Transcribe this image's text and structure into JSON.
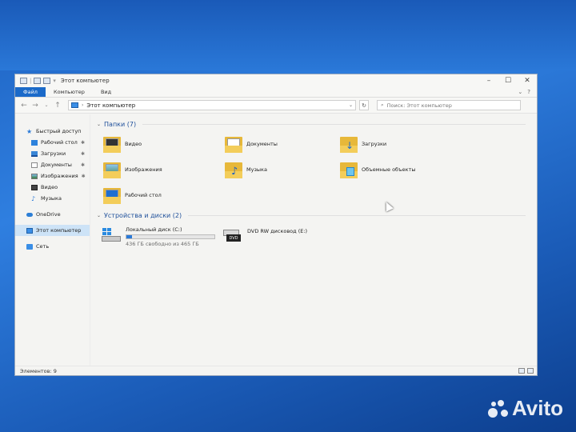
{
  "window": {
    "title": "Этот компьютер",
    "ribbon_tabs": [
      "Файл",
      "Компьютер",
      "Вид"
    ]
  },
  "address": {
    "path": "Этот компьютер",
    "search_placeholder": "Поиск: Этот компьютер"
  },
  "sidebar": {
    "quick_access": "Быстрый доступ",
    "items": [
      {
        "label": "Рабочий стол",
        "icon": "desktop-icon",
        "pinned": true
      },
      {
        "label": "Загрузки",
        "icon": "downloads-icon",
        "pinned": true
      },
      {
        "label": "Документы",
        "icon": "documents-icon",
        "pinned": true
      },
      {
        "label": "Изображения",
        "icon": "pictures-icon",
        "pinned": true
      },
      {
        "label": "Видео",
        "icon": "videos-icon",
        "pinned": false
      },
      {
        "label": "Музыка",
        "icon": "music-icon",
        "pinned": false
      }
    ],
    "onedrive": "OneDrive",
    "this_pc": "Этот компьютер",
    "network": "Сеть",
    "pin_glyph": "📌"
  },
  "folders_group": {
    "title": "Папки (7)",
    "items": [
      {
        "label": "Видео",
        "icon": "videos-folder-icon"
      },
      {
        "label": "Документы",
        "icon": "documents-folder-icon"
      },
      {
        "label": "Загрузки",
        "icon": "downloads-folder-icon"
      },
      {
        "label": "Изображения",
        "icon": "pictures-folder-icon"
      },
      {
        "label": "Музыка",
        "icon": "music-folder-icon"
      },
      {
        "label": "Объемные объекты",
        "icon": "3d-objects-folder-icon"
      },
      {
        "label": "Рабочий стол",
        "icon": "desktop-folder-icon"
      }
    ]
  },
  "drives_group": {
    "title": "Устройства и диски (2)",
    "local": {
      "label": "Локальный диск (C:)",
      "free": "436 ГБ свободно из 465 ГБ",
      "used_fraction": 0.062
    },
    "dvd": {
      "label": "DVD RW дисковод (E:)",
      "badge": "DVD"
    }
  },
  "status": {
    "items_count": "Элементов: 9"
  },
  "watermark": {
    "text": "Avito"
  },
  "colors": {
    "accent": "#1b6ac9",
    "folder": "#e7b83a",
    "desktop": "#1e63c2"
  }
}
